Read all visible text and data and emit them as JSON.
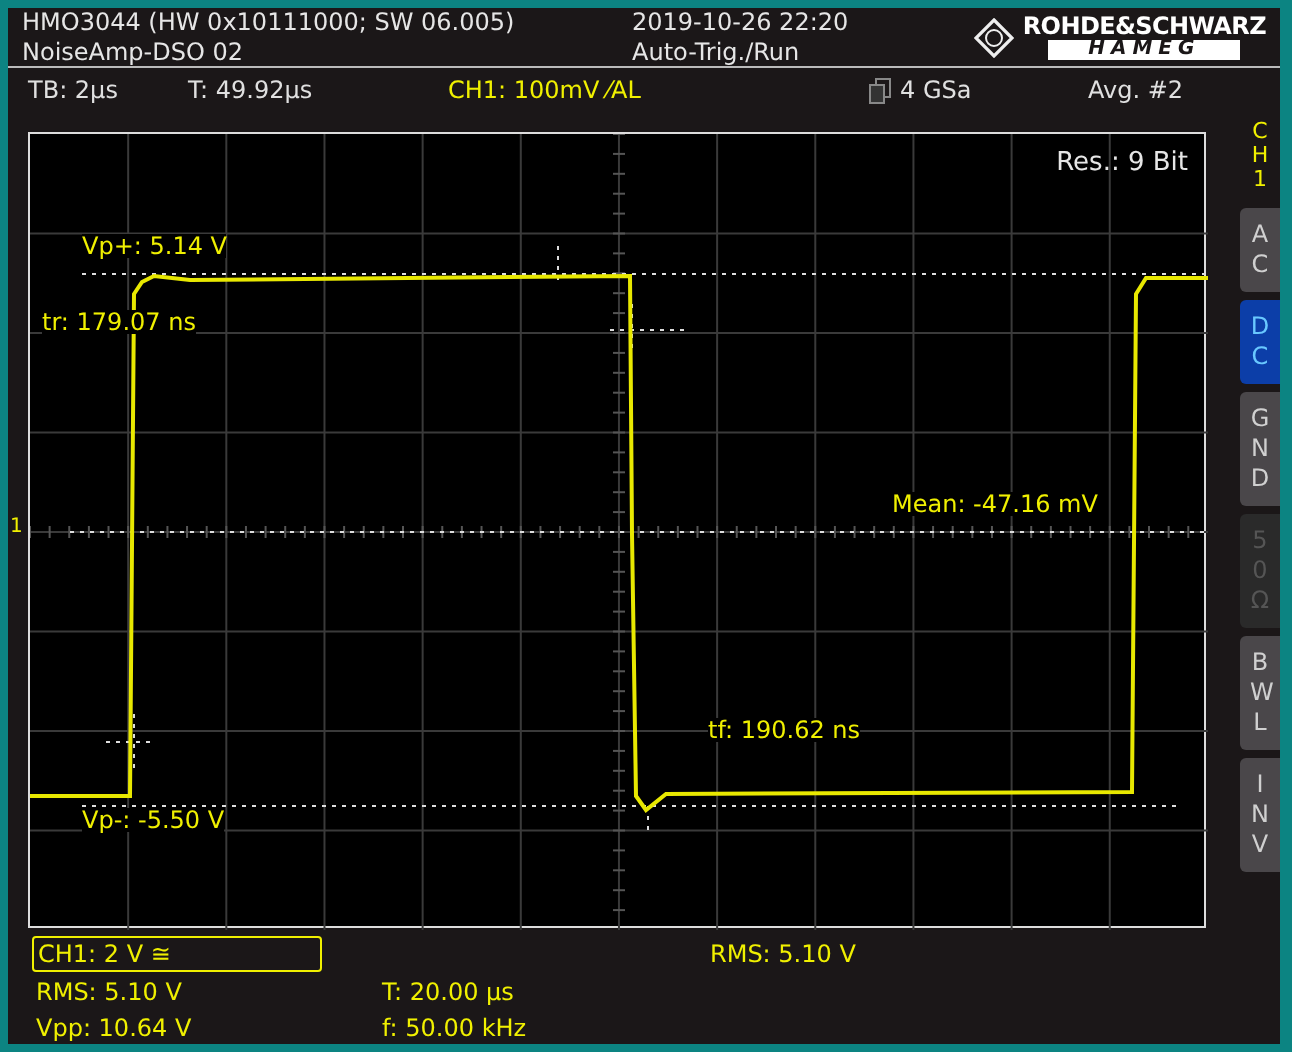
{
  "header": {
    "model_line": "HMO3044 (HW 0x10111000; SW 06.005)",
    "setup_name": "NoiseAmp-DSO 02",
    "datetime": "2019-10-26 22:20",
    "trigger_status": "Auto-Trig./Run",
    "logo": {
      "brand": "ROHDE&SCHWARZ",
      "sub": "HAMEG"
    }
  },
  "status_bar": [
    {
      "kind": "plain",
      "text": "TB: 2µs"
    },
    {
      "kind": "plain",
      "text": "T: 49.92µs"
    },
    {
      "kind": "channel",
      "text": "CH1: 100mV ⁄AL"
    },
    {
      "kind": "memory",
      "text": "4 GSa"
    },
    {
      "kind": "plain",
      "text": "Avg. #2"
    }
  ],
  "plot": {
    "resolution": "Res.: 9 Bit",
    "trigger_channel": "1",
    "labels": [
      {
        "kind": "vp_plus",
        "text": "Vp+: 5.14 V"
      },
      {
        "kind": "tr",
        "text": "tr: 179.07 ns"
      },
      {
        "kind": "mean",
        "text": "Mean: -47.16 mV"
      },
      {
        "kind": "tf",
        "text": "tf: 190.62 ns"
      },
      {
        "kind": "vp_minus",
        "text": "Vp-: -5.50 V"
      }
    ]
  },
  "side_panel": {
    "channel": "CH1",
    "buttons": [
      {
        "label": "AC",
        "selected": false,
        "disabled": false
      },
      {
        "label": "DC",
        "selected": true,
        "disabled": false
      },
      {
        "label": "GND",
        "selected": false,
        "disabled": false
      },
      {
        "label": "50Ω",
        "selected": false,
        "disabled": true
      },
      {
        "label": "BWL",
        "selected": false,
        "disabled": false
      },
      {
        "label": "INV",
        "selected": false,
        "disabled": false
      }
    ]
  },
  "footer": {
    "channel_box": "CH1: 2 V ≅",
    "rms_right": "RMS: 5.10 V",
    "measurements": [
      {
        "text": "RMS: 5.10 V"
      },
      {
        "text": "T: 20.00 µs"
      },
      {
        "text": "Vpp: 10.64 V"
      },
      {
        "text": "f: 50.00 kHz"
      }
    ]
  }
}
